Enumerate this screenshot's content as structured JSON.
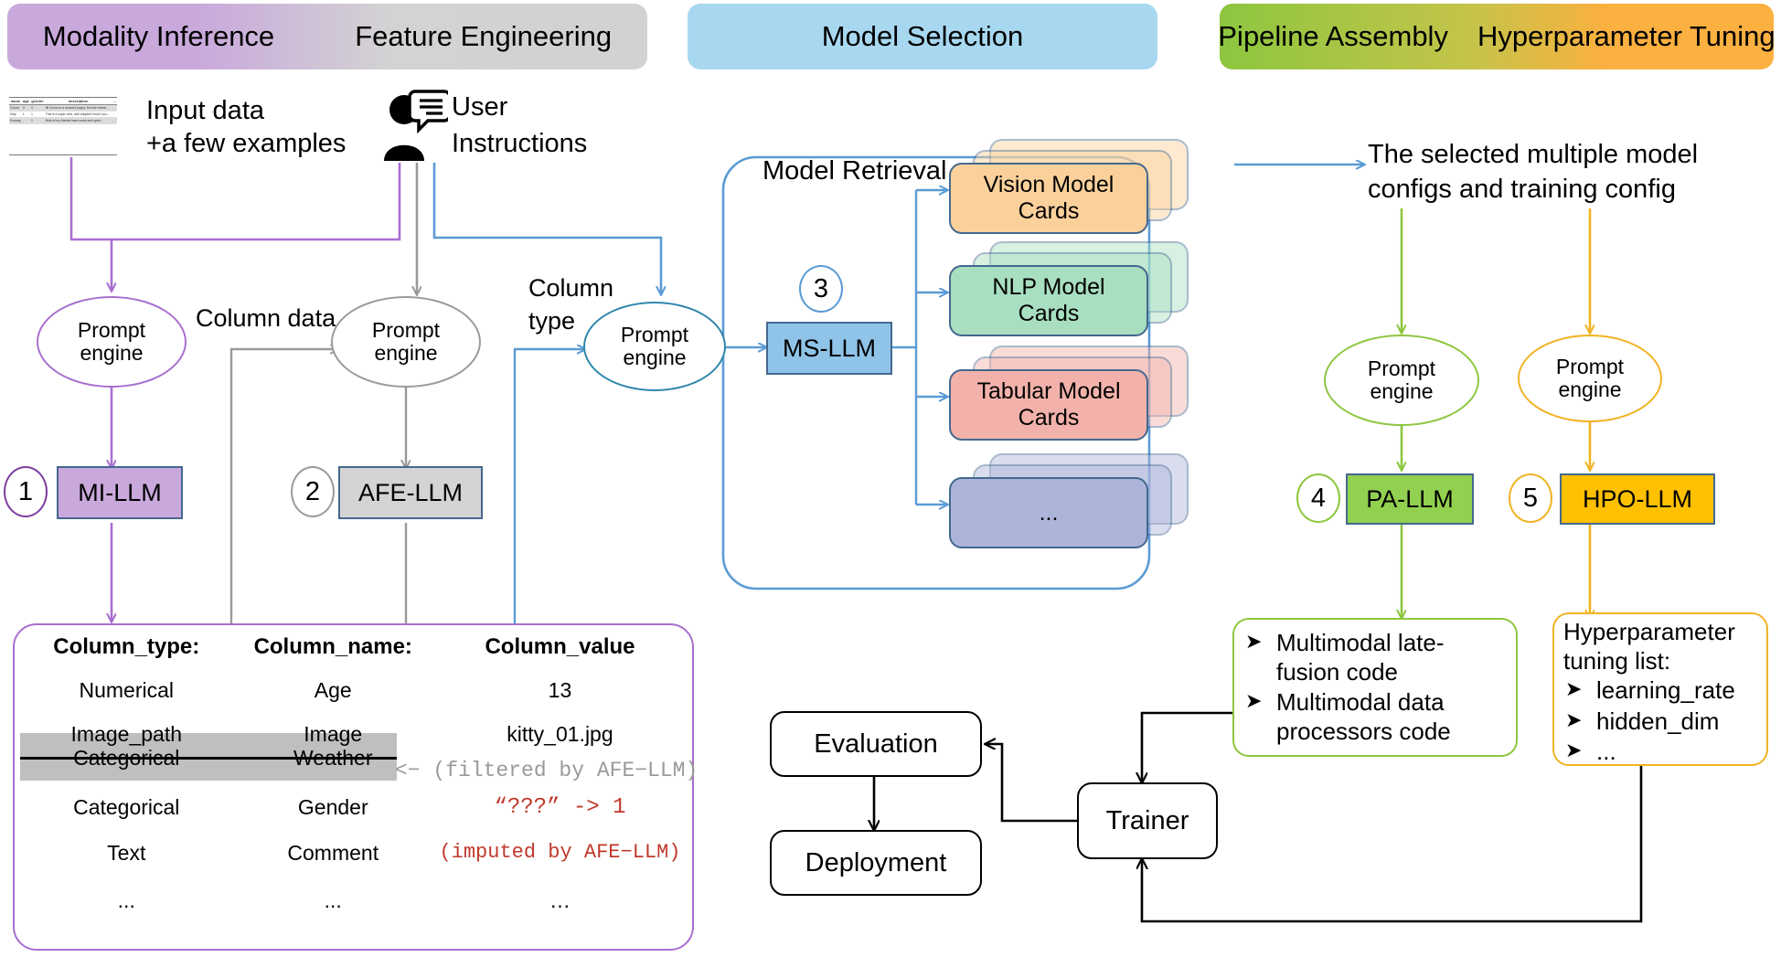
{
  "banners": {
    "modality_inference": "Modality Inference",
    "feature_engineering": "Feature Engineering",
    "model_selection": "Model Selection",
    "pipeline_assembly": "Pipeline Assembly",
    "hyperparameter_tuning": "Hyperparameter Tuning"
  },
  "inputs": {
    "input_data_line1": "Input data",
    "input_data_line2": "+a few examples",
    "user_line1": "User",
    "user_line2": "Instructions",
    "thumb_headers": [
      "name",
      "age",
      "gender",
      "description",
      "..."
    ],
    "thumb_rows": [
      [
        "Cocoa",
        "3",
        "0",
        "fill Cocoa is a rescued puppy, but she needs...",
        "."
      ],
      [
        "Kitty",
        "1",
        "1",
        "This is a super cute, well adopted food if you...",
        "."
      ],
      [
        "Enyang",
        "-",
        "1",
        "Both of my friends have same and speci...",
        "."
      ]
    ]
  },
  "prompt_engines": {
    "label_line1": "Prompt",
    "label_line2": "engine"
  },
  "edge_labels": {
    "column_data": "Column data",
    "column_type_line1": "Column",
    "column_type_line2": "type",
    "selected_models_line1": "The selected multiple model",
    "selected_models_line2": "configs and training config"
  },
  "llms": [
    {
      "num": "1",
      "label": "MI-LLM",
      "fill": "#c9a9dc",
      "accent": "#7b3fa0"
    },
    {
      "num": "2",
      "label": "AFE-LLM",
      "fill": "#d4d4d4",
      "accent": "#9a9a9a"
    },
    {
      "num": "3",
      "label": "MS-LLM",
      "fill": "#8fc3e8",
      "accent": "#4a90c4"
    },
    {
      "num": "4",
      "label": "PA-LLM",
      "fill": "#92d050",
      "accent": "#8dc63f"
    },
    {
      "num": "5",
      "label": "HPO-LLM",
      "fill": "#ffc000",
      "accent": "#f0b323"
    }
  ],
  "model_retrieval": {
    "title": "Model Retrieval",
    "cards": [
      {
        "label": "Vision Model\nCards",
        "fill": "#fbd19b",
        "text": "Vision Model Cards"
      },
      {
        "label": "NLP Model\nCards",
        "fill": "#a8dfc0",
        "text": "NLP Model Cards"
      },
      {
        "label": "Tabular Model\nCards",
        "fill": "#f2b2ab",
        "text": "Tabular Model Cards"
      },
      {
        "label": "...",
        "fill": "#adb4da",
        "text": "..."
      }
    ],
    "card_lines": [
      [
        "Vision Model",
        "Cards"
      ],
      [
        "NLP Model",
        "Cards"
      ],
      [
        "Tabular Model",
        "Cards"
      ],
      [
        "...",
        ""
      ]
    ]
  },
  "column_panel": {
    "headers": [
      "Column_type:",
      "Column_name:",
      "Column_value"
    ],
    "rows": [
      {
        "type": "Numerical",
        "name": "Age",
        "value": "13",
        "style": "plain"
      },
      {
        "type": "Image_path",
        "name": "Image",
        "value": "kitty_01.jpg",
        "style": "plain"
      },
      {
        "type": "Categorical",
        "name": "Weather",
        "value": "",
        "style": "filtered"
      },
      {
        "type": "Categorical",
        "name": "Gender",
        "value": "“???” -> 1",
        "style": "imputed-value"
      },
      {
        "type": "Text",
        "name": "Comment",
        "value": "(imputed by AFE−LLM)",
        "style": "imputed-note"
      },
      {
        "type": "...",
        "name": "...",
        "value": "…",
        "style": "plain"
      }
    ],
    "filtered_note": "<− (filtered by AFE−LLM)"
  },
  "pipeline_box": {
    "items": [
      "Multimodal late-fusion code",
      "Multimodal data processors code"
    ],
    "item_lines": [
      [
        "Multimodal late-",
        "fusion code"
      ],
      [
        "Multimodal data",
        "processors code"
      ]
    ],
    "bullet_glyph": "➤"
  },
  "hpo_box": {
    "title_line1": "Hyperparameter",
    "title_line2": "tuning list:",
    "items": [
      "learning_rate",
      "hidden_dim",
      "..."
    ],
    "bullet_glyph": "➤"
  },
  "pipeline_flow": {
    "trainer": "Trainer",
    "evaluation": "Evaluation",
    "deployment": "Deployment"
  },
  "colors": {
    "purple": "#a96fd0",
    "gray": "#9a9a9a",
    "blue": "#5b9bd5",
    "green": "#8dc63f",
    "yellow": "#f0b323",
    "black": "#000000",
    "red": "#c0392b",
    "banner_purple": "#c9a9dc",
    "banner_gray": "#d3d3d3",
    "banner_blue": "#a8d8f0",
    "banner_green": "#8dc63f",
    "banner_orange": "#fbb040"
  }
}
